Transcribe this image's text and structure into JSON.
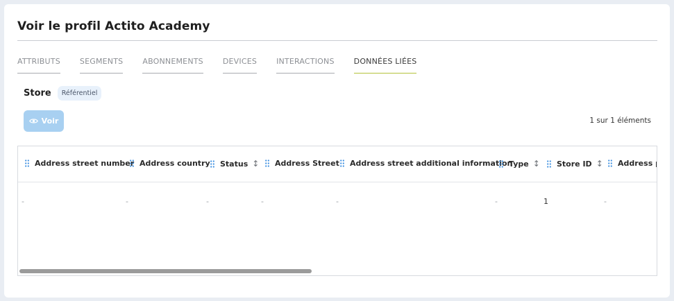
{
  "page": {
    "title": "Voir le profil Actito Academy"
  },
  "tabs": [
    {
      "label": "ATTRIBUTS",
      "active": false
    },
    {
      "label": "SEGMENTS",
      "active": false
    },
    {
      "label": "ABONNEMENTS",
      "active": false
    },
    {
      "label": "DEVICES",
      "active": false
    },
    {
      "label": "INTERACTIONS",
      "active": false
    },
    {
      "label": "DONNÉES LIÉES",
      "active": true
    }
  ],
  "section": {
    "title": "Store",
    "badge": "Référentiel"
  },
  "toolbar": {
    "view_button_label": "Voir",
    "view_button_icon": "eye-icon",
    "count_text": "1 sur 1 éléments"
  },
  "table": {
    "columns": [
      {
        "label": "Address street number",
        "sortable": false
      },
      {
        "label": "Address country",
        "sortable": false
      },
      {
        "label": "Status",
        "sortable": true
      },
      {
        "label": "Address Street",
        "sortable": false
      },
      {
        "label": "Address street additional information",
        "sortable": false
      },
      {
        "label": "Type",
        "sortable": true
      },
      {
        "label": "Store ID",
        "sortable": true
      },
      {
        "label": "Address po",
        "sortable": false
      }
    ],
    "rows": [
      [
        "-",
        "-",
        "-",
        "-",
        "-",
        "-",
        "1",
        "-"
      ]
    ]
  },
  "colors": {
    "accent_blue": "#3d8fe0",
    "button_disabled": "#a8d0f1",
    "active_tab_underline": "#b4c23a",
    "badge_bg": "#e8f1fb"
  }
}
